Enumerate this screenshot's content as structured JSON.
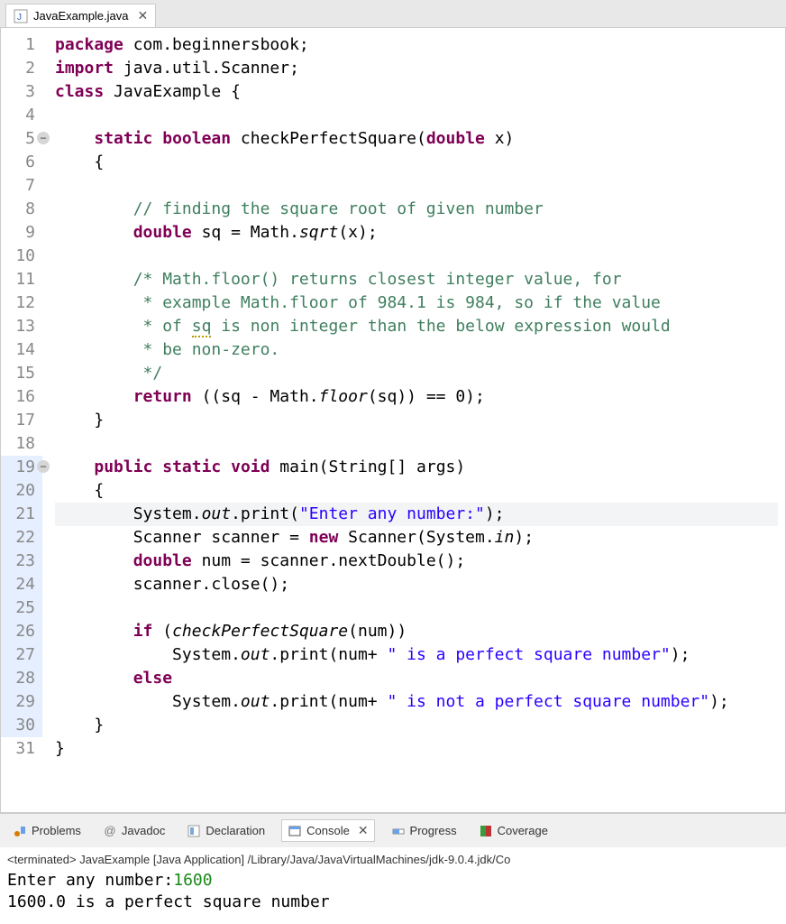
{
  "editor": {
    "tab_label": "JavaExample.java",
    "lines": [
      {
        "n": "1",
        "html": "<span class='kw'>package</span> com.beginnersbook;"
      },
      {
        "n": "2",
        "html": "<span class='kw'>import</span> java.util.Scanner;"
      },
      {
        "n": "3",
        "html": "<span class='kw'>class</span> JavaExample {"
      },
      {
        "n": "4",
        "html": ""
      },
      {
        "n": "5",
        "fold": true,
        "html": "    <span class='kw'>static</span> <span class='kw'>boolean</span> checkPerfectSquare(<span class='kw'>double</span> x)"
      },
      {
        "n": "6",
        "html": "    {"
      },
      {
        "n": "7",
        "html": ""
      },
      {
        "n": "8",
        "html": "        <span class='cm'>// finding the square root of given number</span>"
      },
      {
        "n": "9",
        "html": "        <span class='kw'>double</span> sq = Math.<span class='it'>sqrt</span>(x);"
      },
      {
        "n": "10",
        "html": ""
      },
      {
        "n": "11",
        "html": "        <span class='cm'>/* Math.floor() returns closest integer value, for</span>"
      },
      {
        "n": "12",
        "html": "        <span class='cm'> * example Math.floor of 984.1 is 984, so if the value</span>"
      },
      {
        "n": "13",
        "html": "        <span class='cm'> * of <span class='warn'>sq</span> is non integer than the below expression would</span>"
      },
      {
        "n": "14",
        "html": "        <span class='cm'> * be non-zero.</span>"
      },
      {
        "n": "15",
        "html": "        <span class='cm'> */</span>"
      },
      {
        "n": "16",
        "html": "        <span class='kw'>return</span> ((sq - Math.<span class='it'>floor</span>(sq)) == 0);"
      },
      {
        "n": "17",
        "html": "    }"
      },
      {
        "n": "18",
        "html": ""
      },
      {
        "n": "19",
        "fold": true,
        "hlStrip": true,
        "html": "    <span class='kw'>public</span> <span class='kw'>static</span> <span class='kw'>void</span> main(String[] args)"
      },
      {
        "n": "20",
        "hlStrip": true,
        "html": "    {"
      },
      {
        "n": "21",
        "hlStrip": true,
        "hlLine": true,
        "html": "        System.<span class='it'>out</span>.print(<span class='str'>\"Enter any number:\"</span>);"
      },
      {
        "n": "22",
        "hlStrip": true,
        "html": "        Scanner scanner = <span class='kw'>new</span> Scanner(System.<span class='it'>in</span>);"
      },
      {
        "n": "23",
        "hlStrip": true,
        "html": "        <span class='kw'>double</span> num = scanner.nextDouble();"
      },
      {
        "n": "24",
        "hlStrip": true,
        "html": "        scanner.close();"
      },
      {
        "n": "25",
        "hlStrip": true,
        "html": ""
      },
      {
        "n": "26",
        "hlStrip": true,
        "html": "        <span class='kw'>if</span> (<span class='it'>checkPerfectSquare</span>(num))"
      },
      {
        "n": "27",
        "hlStrip": true,
        "html": "            System.<span class='it'>out</span>.print(num+ <span class='str'>\" is a perfect square number\"</span>);"
      },
      {
        "n": "28",
        "hlStrip": true,
        "html": "        <span class='kw'>else</span>"
      },
      {
        "n": "29",
        "hlStrip": true,
        "html": "            System.<span class='it'>out</span>.print(num+ <span class='str'>\" is not a perfect square number\"</span>);"
      },
      {
        "n": "30",
        "hlStrip": true,
        "html": "    }"
      },
      {
        "n": "31",
        "html": "}"
      }
    ]
  },
  "views": {
    "problems": "Problems",
    "javadoc": "Javadoc",
    "declaration": "Declaration",
    "console": "Console",
    "progress": "Progress",
    "coverage": "Coverage"
  },
  "console": {
    "status": "<terminated> JavaExample [Java Application] /Library/Java/JavaVirtualMachines/jdk-9.0.4.jdk/Co",
    "prompt": "Enter any number:",
    "input": "1600",
    "output": "1600.0 is a perfect square number"
  }
}
